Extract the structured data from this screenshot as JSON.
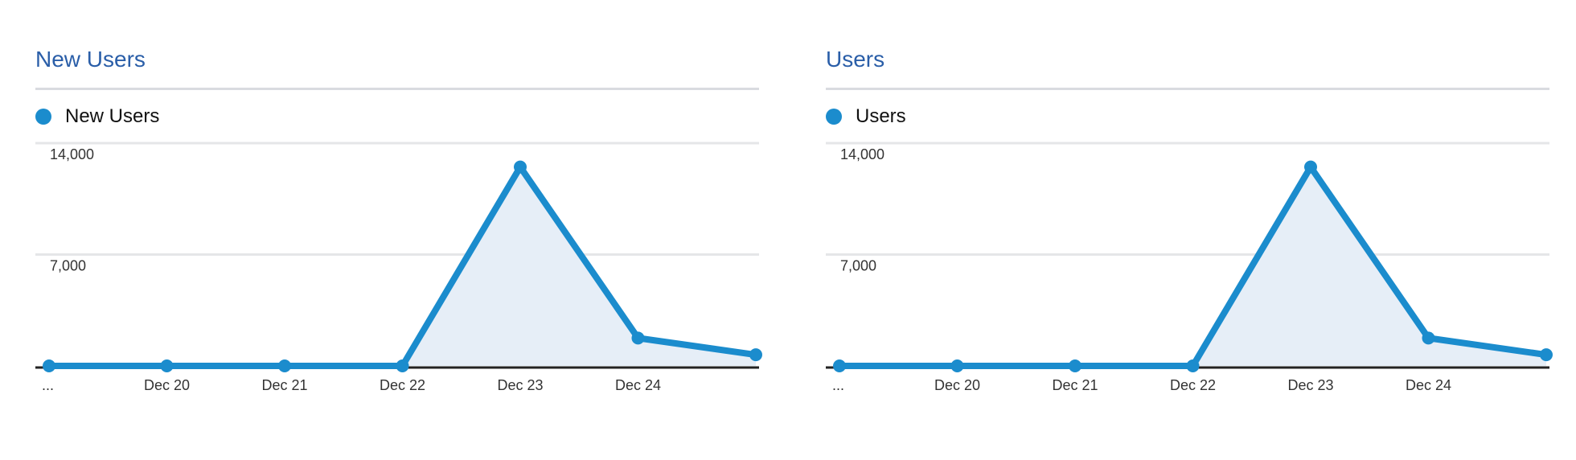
{
  "colors": {
    "series": "#1b8ccd",
    "fill": "#e6eef7",
    "title": "#2a5ea8",
    "grid": "#e5e6e8",
    "baseline": "#222222"
  },
  "chart_data": [
    {
      "type": "area",
      "title": "New Users",
      "legend": "top-left",
      "grid": true,
      "x": [
        "...",
        "Dec 20",
        "Dec 21",
        "Dec 22",
        "Dec 23",
        "Dec 24",
        ""
      ],
      "ylim": [
        0,
        14000
      ],
      "yticks": [
        "7,000",
        "14,000"
      ],
      "series": [
        {
          "name": "New Users",
          "values": [
            0,
            0,
            0,
            0,
            12500,
            1750,
            700
          ]
        }
      ]
    },
    {
      "type": "area",
      "title": "Users",
      "legend": "top-left",
      "grid": true,
      "x": [
        "...",
        "Dec 20",
        "Dec 21",
        "Dec 22",
        "Dec 23",
        "Dec 24",
        ""
      ],
      "ylim": [
        0,
        14000
      ],
      "yticks": [
        "7,000",
        "14,000"
      ],
      "series": [
        {
          "name": "Users",
          "values": [
            0,
            0,
            0,
            0,
            12500,
            1750,
            700
          ]
        }
      ]
    }
  ]
}
